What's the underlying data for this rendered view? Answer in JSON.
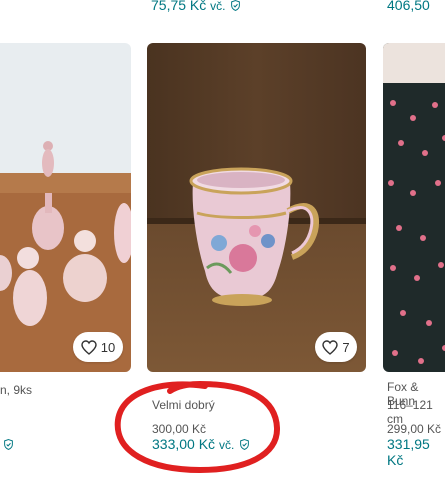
{
  "top_row": {
    "center_price": "75,75 Kč",
    "center_incl": "vč.",
    "right_price": "406,50"
  },
  "cards": [
    {
      "title": "n, 9ks",
      "likes": "10"
    },
    {
      "condition": "Velmi dobrý",
      "price": "300,00 Kč",
      "price_incl": "333,00 Kč",
      "incl_label": "vč.",
      "likes": "7"
    },
    {
      "title": "Fox & Bunn",
      "size": "116–121 cm",
      "price": "299,00 Kč",
      "price_incl": "331,95 Kč"
    }
  ],
  "colors": {
    "accent": "#007782",
    "annotation": "#e02020"
  }
}
